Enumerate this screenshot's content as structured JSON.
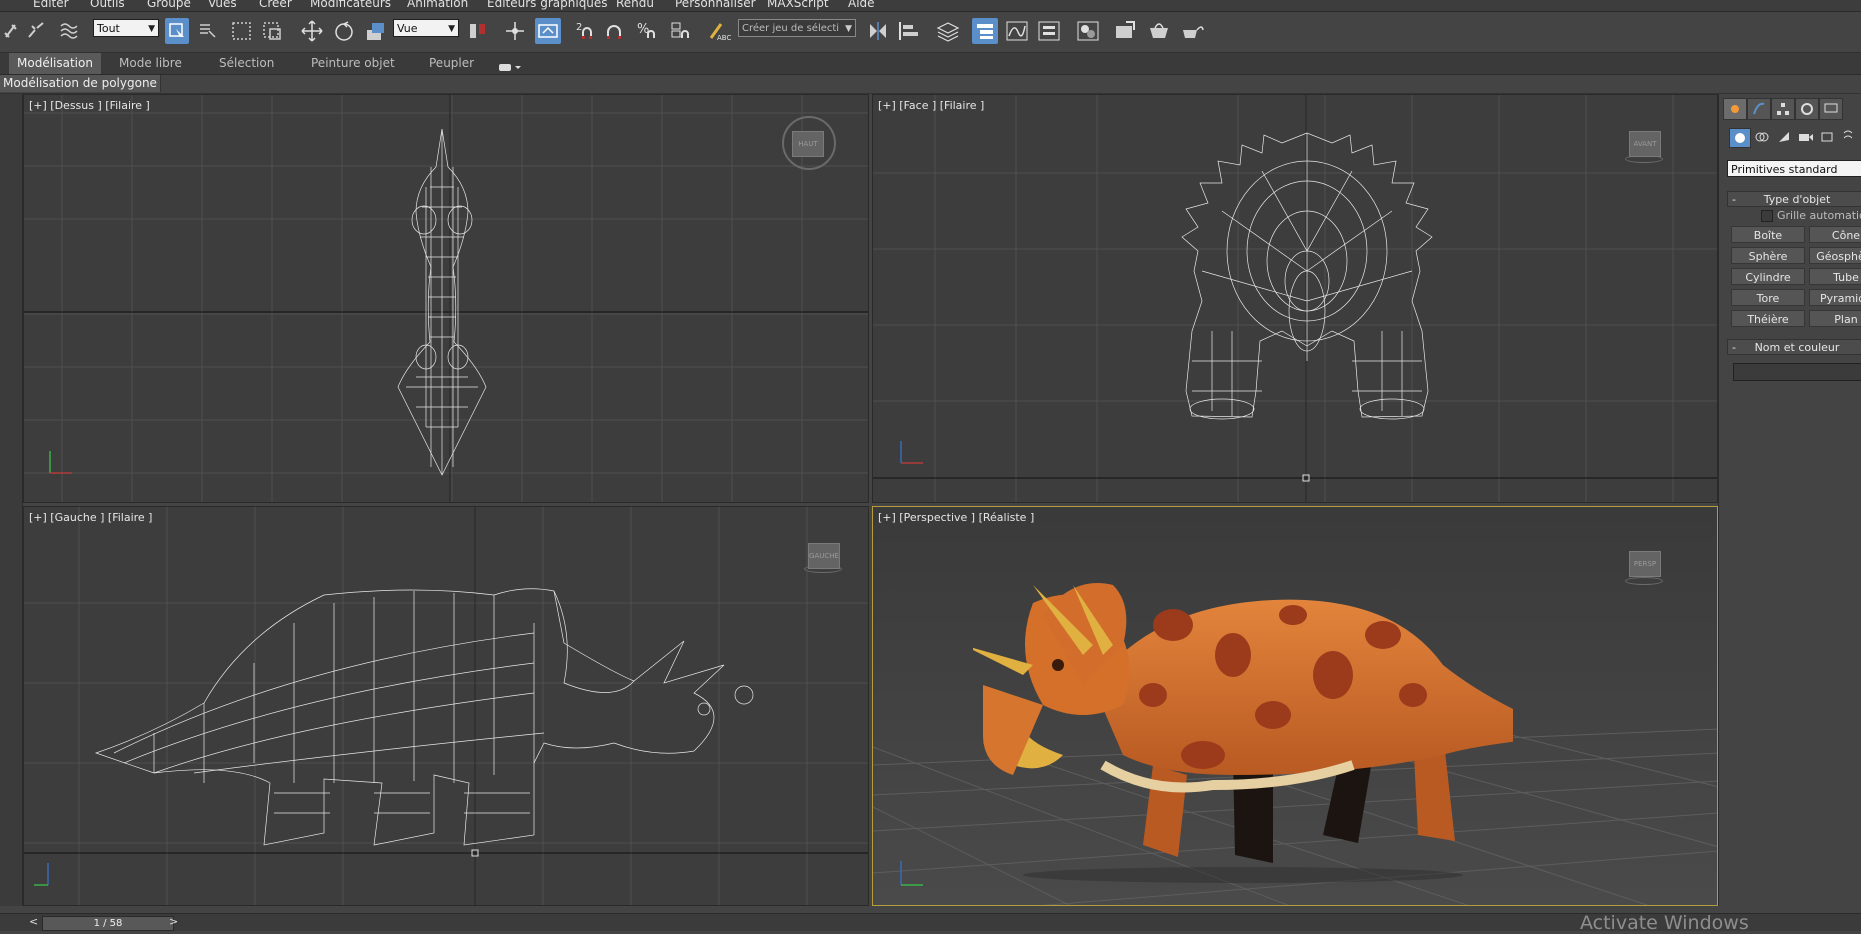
{
  "menu": [
    "Editer",
    "Outils",
    "Groupe",
    "Vues",
    "Créer",
    "Modificateurs",
    "Animation",
    "Editeurs graphiques",
    "Rendu",
    "Personnaliser",
    "MAXScript",
    "Aide"
  ],
  "toolbar": {
    "filter_select": "Tout",
    "coord_select": "Vue",
    "named_selection_placeholder": "Créer jeu de sélecti"
  },
  "ribbon": {
    "tabs": [
      "Modélisation",
      "Mode libre",
      "Sélection",
      "Peinture objet",
      "Peupler"
    ],
    "active_tab": "Modélisation",
    "sub_label": "Modélisation de polygone"
  },
  "viewports": {
    "top": {
      "label": "[+] [Dessus ] [Filaire ]",
      "cube": "HAUT"
    },
    "front": {
      "label": "[+] [Face ] [Filaire ]",
      "cube": "AVANT"
    },
    "left": {
      "label": "[+] [Gauche ] [Filaire ]",
      "cube": "GAUCHE"
    },
    "perspective": {
      "label": "[+] [Perspective ] [Réaliste ]",
      "cube": "PERSP"
    }
  },
  "command_panel": {
    "dropdown": "Primitives standard",
    "rollout_object_type": "Type d'objet",
    "autogrid_label": "Grille automatique",
    "buttons": [
      "Boîte",
      "Cône",
      "Sphère",
      "Géosphère",
      "Cylindre",
      "Tube",
      "Tore",
      "Pyramide",
      "Théière",
      "Plan"
    ],
    "rollout_name_color": "Nom et couleur"
  },
  "timeline": {
    "frame": "1 / 58",
    "prev": "<",
    "next": ">"
  },
  "watermark": "Activate Windows",
  "colors": {
    "accent": "#5b8fc9",
    "active_viewport_border": "#b59c3c",
    "dino_body": "#d4702a",
    "dino_spots": "#9c3a1c"
  }
}
